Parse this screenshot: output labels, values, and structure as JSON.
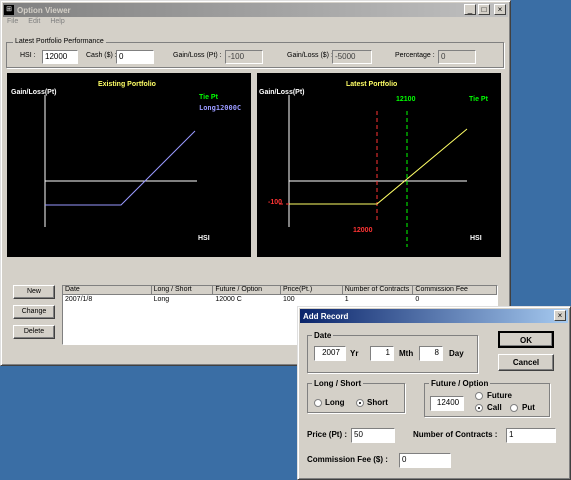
{
  "main_window": {
    "title": "Option Viewer",
    "menu": [
      "File",
      "Edit",
      "Help"
    ],
    "icon": "app-grid-icon",
    "controls": [
      "minimize-icon",
      "maximize-icon",
      "close-icon"
    ],
    "control_glyphs": [
      "_",
      "□",
      "×"
    ],
    "perf_group_label": "Latest Portfolio Performance",
    "hsi_label": "HSI :",
    "hsi_value": "12000",
    "cash_label": "Cash ($) :",
    "cash_value": "0",
    "gl_pt_label": "Gain/Loss (Pt) :",
    "gl_pt_value": "-100",
    "gl_dollar_label": "Gain/Loss ($) :",
    "gl_dollar_value": "-5000",
    "pct_label": "Percentage :",
    "pct_value": "0"
  },
  "existing_chart": {
    "title": "Existing Portfolio",
    "ylabel": "Gain/Loss(Pt)",
    "xlabel": "HSI",
    "legend": [
      "Tie Pt",
      "Long12000C"
    ]
  },
  "latest_chart": {
    "title": "Latest Portfolio",
    "ylabel": "Gain/Loss(Pt)",
    "xlabel": "HSI",
    "tie_legend": "Tie Pt",
    "tie_value": "12100",
    "min_value": "-100",
    "strike_value": "12000"
  },
  "colors": {
    "chart_title": "#ffff66",
    "tie": "#00ff00",
    "series_existing": "#9999ff",
    "payoff_latest": "#ffff66",
    "loss": "#ff3333",
    "axis": "#ffffff"
  },
  "buttons": {
    "new": "New",
    "change": "Change",
    "delete": "Delete"
  },
  "table": {
    "columns": [
      "Date",
      "Long / Short",
      "Future / Option",
      "Price(Pt.)",
      "Number of Contracts",
      "Commission Fee"
    ],
    "rows": [
      [
        "2007/1/8",
        "Long",
        "12000 C",
        "100",
        "1",
        "0"
      ]
    ]
  },
  "add_record": {
    "title": "Add Record",
    "date_label": "Date",
    "year": "2007",
    "yr_label": "Yr",
    "month": "1",
    "mth_label": "Mth",
    "day": "8",
    "day_label": "Day",
    "ok": "OK",
    "cancel": "Cancel",
    "close_glyph": "×",
    "ls_label": "Long / Short",
    "long": "Long",
    "short": "Short",
    "ls_selected": "Short",
    "fo_label": "Future / Option",
    "fo_value": "12400",
    "future": "Future",
    "call": "Call",
    "put": "Put",
    "fo_selected": "Call",
    "price_label": "Price (Pt) :",
    "price_value": "50",
    "contracts_label": "Number of Contracts :",
    "contracts_value": "1",
    "fee_label": "Commission Fee ($) :",
    "fee_value": "0"
  }
}
